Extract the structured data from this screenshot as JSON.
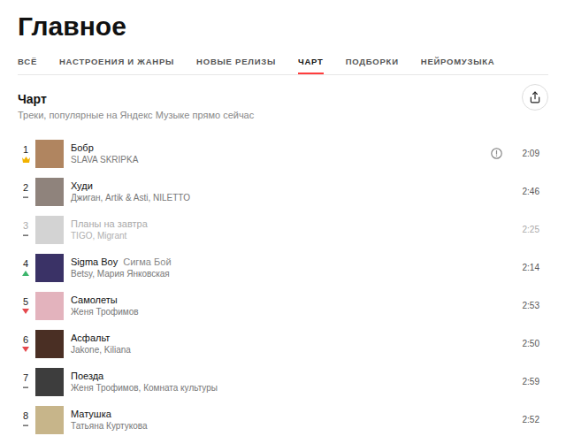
{
  "page": {
    "title": "Главное"
  },
  "tabs": [
    {
      "label": "ВСЁ",
      "selected": false
    },
    {
      "label": "НАСТРОЕНИЯ И ЖАНРЫ",
      "selected": false
    },
    {
      "label": "НОВЫЕ РЕЛИЗЫ",
      "selected": false
    },
    {
      "label": "ЧАРТ",
      "selected": true
    },
    {
      "label": "ПОДБОРКИ",
      "selected": false
    },
    {
      "label": "НЕЙРОМУЗЫКА",
      "selected": false
    }
  ],
  "chart": {
    "title": "Чарт",
    "subtitle": "Треки, популярные на Яндекс Музыке прямо сейчас",
    "tracks": [
      {
        "rank": "1",
        "trend": "crown",
        "title": "Бобр",
        "artists": "SLAVA SKRIPKA",
        "explicit": true,
        "available": true,
        "duration": "2:09",
        "color": "#b08560"
      },
      {
        "rank": "2",
        "trend": "same",
        "title": "Худи",
        "artists": "Джиган, Artik & Asti, NILETTO",
        "explicit": false,
        "available": true,
        "duration": "2:46",
        "color": "#8f837c"
      },
      {
        "rank": "3",
        "trend": "same",
        "title": "Планы на завтра",
        "artists": "TIGO, Migrant",
        "explicit": false,
        "available": false,
        "duration": "2:25",
        "color": "#b5b5b5"
      },
      {
        "rank": "4",
        "trend": "up",
        "title": "Sigma Boy",
        "version": "Сигма Бой",
        "artists": "Betsy, Мария Янковская",
        "explicit": false,
        "available": true,
        "duration": "2:14",
        "color": "#3a3266"
      },
      {
        "rank": "5",
        "trend": "down",
        "title": "Самолеты",
        "artists": "Женя Трофимов",
        "explicit": false,
        "available": true,
        "duration": "2:53",
        "color": "#e3b3bd"
      },
      {
        "rank": "6",
        "trend": "down",
        "title": "Асфальт",
        "artists": "Jakone, Kiliana",
        "explicit": false,
        "available": true,
        "duration": "2:50",
        "color": "#4a2f24"
      },
      {
        "rank": "7",
        "trend": "same",
        "title": "Поезда",
        "artists": "Женя Трофимов, Комната культуры",
        "explicit": false,
        "available": true,
        "duration": "2:59",
        "color": "#3d3d3d"
      },
      {
        "rank": "8",
        "trend": "same",
        "title": "Матушка",
        "artists": "Татьяна Куртукова",
        "explicit": false,
        "available": true,
        "duration": "2:52",
        "color": "#c7b58a"
      }
    ]
  }
}
